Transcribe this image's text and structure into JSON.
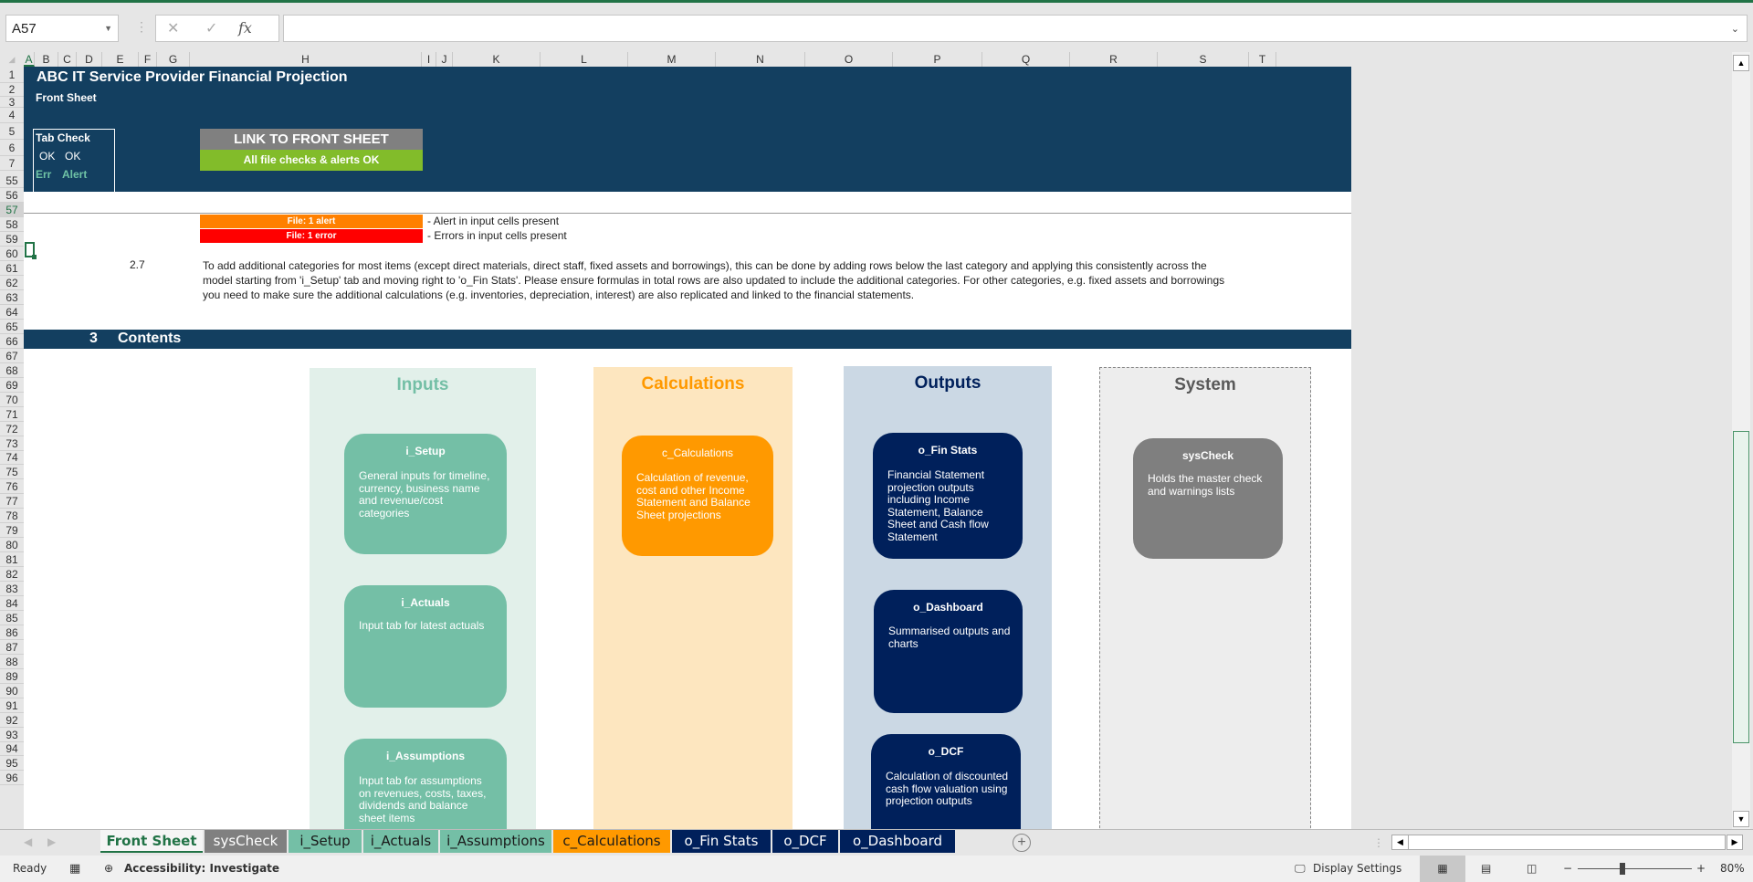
{
  "formula_bar": {
    "name_box": "A57",
    "cancel_icon": "✕",
    "enter_icon": "✓",
    "fx_label": "fx",
    "formula": ""
  },
  "columns": [
    "A",
    "B",
    "C",
    "D",
    "E",
    "F",
    "G",
    "H",
    "I",
    "J",
    "K",
    "L",
    "M",
    "N",
    "O",
    "P",
    "Q",
    "R",
    "S",
    "T"
  ],
  "rows": [
    "1",
    "2",
    "3",
    "4",
    "5",
    "6",
    "7",
    "55",
    "56",
    "57",
    "58",
    "59",
    "60",
    "61",
    "62",
    "63",
    "64",
    "65",
    "66",
    "67",
    "68",
    "69",
    "70",
    "71",
    "72",
    "73",
    "74",
    "75",
    "76",
    "77",
    "78",
    "79",
    "80",
    "81",
    "82",
    "83",
    "84",
    "85",
    "86",
    "87",
    "88",
    "89",
    "90",
    "91",
    "92",
    "93",
    "94",
    "95",
    "96"
  ],
  "header": {
    "title": "ABC IT Service Provider Financial Projection",
    "subtitle": "Front Sheet",
    "tab_check": {
      "label": "Tab Check",
      "err_value": "OK",
      "alert_value": "OK",
      "err_label": "Err",
      "alert_label": "Alert"
    },
    "link_button": "LINK TO FRONT SHEET",
    "status_ok": "All file checks & alerts OK"
  },
  "legend": [
    {
      "box": "File: 1 alert",
      "desc": "- Alert in input cells present",
      "color": "#ff8000"
    },
    {
      "box": "File: 1 error",
      "desc": "- Errors in input cells present",
      "color": "#ff0000"
    }
  ],
  "note": {
    "number": "2.7",
    "text": "To add additional categories for most items (except direct materials, direct staff, fixed assets and borrowings), this can be done by adding rows below the last category and applying this consistently across the model starting from 'i_Setup' tab and moving right to 'o_Fin Stats'. Please ensure formulas in total rows are also updated to include the additional categories. For other categories, e.g. fixed assets and borrowings you need to make sure the additional calculations (e.g. inventories, depreciation, interest) are also replicated and linked to the financial statements."
  },
  "section": {
    "number": "3",
    "title": "Contents"
  },
  "groups": [
    {
      "title": "Inputs",
      "color": "#74bfa6",
      "bg": "#e2f0ea",
      "cards": [
        {
          "title": "i_Setup",
          "desc": "General inputs for timeline, currency, business name and revenue/cost categories"
        },
        {
          "title": "i_Actuals",
          "desc": "Input tab for latest actuals"
        },
        {
          "title": "i_Assumptions",
          "desc": "Input tab for assumptions on revenues, costs, taxes, dividends and balance sheet items"
        }
      ]
    },
    {
      "title": "Calculations",
      "color": "#ff9900",
      "bg": "#fde6bf",
      "cards": [
        {
          "title": "c_Calculations",
          "desc": "Calculation of revenue, cost and other Income Statement and Balance Sheet projections"
        }
      ]
    },
    {
      "title": "Outputs",
      "color": "#00205b",
      "bg": "#cbd8e4",
      "cards": [
        {
          "title": "o_Fin Stats",
          "desc": "Financial Statement projection outputs including Income Statement, Balance Sheet and Cash flow Statement"
        },
        {
          "title": "o_Dashboard",
          "desc": "Summarised outputs and charts"
        },
        {
          "title": "o_DCF",
          "desc": "Calculation of discounted cash flow valuation using projection outputs"
        }
      ]
    },
    {
      "title": "System",
      "color": "#7f7f7f",
      "bg": "#ededed",
      "cards": [
        {
          "title": "sysCheck",
          "desc": "Holds the master check and warnings lists"
        }
      ]
    }
  ],
  "sheet_tabs": [
    {
      "label": "Front Sheet",
      "active": true
    },
    {
      "label": "sysCheck",
      "bg": "#808080",
      "fg": "#ffffff"
    },
    {
      "label": "i_Setup",
      "bg": "#74bfa6",
      "fg": "#1a1a1a"
    },
    {
      "label": "i_Actuals",
      "bg": "#74bfa6",
      "fg": "#1a1a1a"
    },
    {
      "label": "i_Assumptions",
      "bg": "#74bfa6",
      "fg": "#1a1a1a"
    },
    {
      "label": "c_Calculations",
      "bg": "#ff9900",
      "fg": "#1a1a1a"
    },
    {
      "label": "o_Fin Stats",
      "bg": "#00205b",
      "fg": "#ffffff"
    },
    {
      "label": "o_DCF",
      "bg": "#00205b",
      "fg": "#ffffff"
    },
    {
      "label": "o_Dashboard",
      "bg": "#00205b",
      "fg": "#ffffff"
    }
  ],
  "status_bar": {
    "ready": "Ready",
    "accessibility": "Accessibility: Investigate",
    "display_settings": "Display Settings",
    "zoom": "80%"
  }
}
